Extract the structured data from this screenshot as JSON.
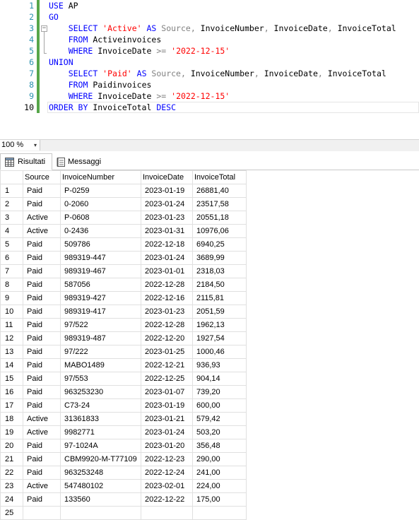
{
  "editor": {
    "lines": [
      {
        "n": "1",
        "tokens": [
          {
            "c": "kw",
            "t": "USE "
          },
          {
            "c": "plain",
            "t": "AP"
          }
        ]
      },
      {
        "n": "2",
        "tokens": [
          {
            "c": "kw",
            "t": "GO"
          }
        ]
      },
      {
        "n": "3",
        "tokens": [
          {
            "c": "plain",
            "t": "    "
          },
          {
            "c": "kw",
            "t": "SELECT "
          },
          {
            "c": "str",
            "t": "'Active'"
          },
          {
            "c": "kw",
            "t": " AS "
          },
          {
            "c": "fn",
            "t": "Source"
          },
          {
            "c": "op",
            "t": ", "
          },
          {
            "c": "plain",
            "t": "InvoiceNumber"
          },
          {
            "c": "op",
            "t": ", "
          },
          {
            "c": "plain",
            "t": "InvoiceDate"
          },
          {
            "c": "op",
            "t": ", "
          },
          {
            "c": "plain",
            "t": "InvoiceTotal"
          }
        ]
      },
      {
        "n": "4",
        "tokens": [
          {
            "c": "plain",
            "t": "    "
          },
          {
            "c": "kw",
            "t": "FROM "
          },
          {
            "c": "plain",
            "t": "Activeinvoices"
          }
        ]
      },
      {
        "n": "5",
        "tokens": [
          {
            "c": "plain",
            "t": "    "
          },
          {
            "c": "kw",
            "t": "WHERE "
          },
          {
            "c": "plain",
            "t": "InvoiceDate "
          },
          {
            "c": "op",
            "t": ">="
          },
          {
            "c": "plain",
            "t": " "
          },
          {
            "c": "str",
            "t": "'2022-12-15'"
          }
        ]
      },
      {
        "n": "6",
        "tokens": [
          {
            "c": "kw",
            "t": "UNION"
          }
        ]
      },
      {
        "n": "7",
        "tokens": [
          {
            "c": "plain",
            "t": "    "
          },
          {
            "c": "kw",
            "t": "SELECT "
          },
          {
            "c": "str",
            "t": "'Paid'"
          },
          {
            "c": "kw",
            "t": " AS "
          },
          {
            "c": "fn",
            "t": "Source"
          },
          {
            "c": "op",
            "t": ", "
          },
          {
            "c": "plain",
            "t": "InvoiceNumber"
          },
          {
            "c": "op",
            "t": ", "
          },
          {
            "c": "plain",
            "t": "InvoiceDate"
          },
          {
            "c": "op",
            "t": ", "
          },
          {
            "c": "plain",
            "t": "InvoiceTotal"
          }
        ]
      },
      {
        "n": "8",
        "tokens": [
          {
            "c": "plain",
            "t": "    "
          },
          {
            "c": "kw",
            "t": "FROM "
          },
          {
            "c": "plain",
            "t": "Paidinvoices"
          }
        ]
      },
      {
        "n": "9",
        "tokens": [
          {
            "c": "plain",
            "t": "    "
          },
          {
            "c": "kw",
            "t": "WHERE "
          },
          {
            "c": "plain",
            "t": "InvoiceDate "
          },
          {
            "c": "op",
            "t": ">="
          },
          {
            "c": "plain",
            "t": " "
          },
          {
            "c": "str",
            "t": "'2022-12-15'"
          }
        ]
      },
      {
        "n": "10",
        "tokens": [
          {
            "c": "kw",
            "t": "ORDER BY "
          },
          {
            "c": "plain",
            "t": "InvoiceTotal "
          },
          {
            "c": "kw",
            "t": "DESC"
          }
        ]
      }
    ],
    "fold_marker": "−"
  },
  "zoom": {
    "value": "100 %",
    "arrow": "▾"
  },
  "tabs": {
    "results_label": "Risultati",
    "messages_label": "Messaggi"
  },
  "grid": {
    "columns": [
      "",
      "Source",
      "InvoiceNumber",
      "InvoiceDate",
      "InvoiceTotal"
    ],
    "rows": [
      [
        "1",
        "Paid",
        "P-0259",
        "2023-01-19",
        "26881,40"
      ],
      [
        "2",
        "Paid",
        "0-2060",
        "2023-01-24",
        "23517,58"
      ],
      [
        "3",
        "Active",
        "P-0608",
        "2023-01-23",
        "20551,18"
      ],
      [
        "4",
        "Active",
        "0-2436",
        "2023-01-31",
        "10976,06"
      ],
      [
        "5",
        "Paid",
        "509786",
        "2022-12-18",
        "6940,25"
      ],
      [
        "6",
        "Paid",
        "989319-447",
        "2023-01-24",
        "3689,99"
      ],
      [
        "7",
        "Paid",
        "989319-467",
        "2023-01-01",
        "2318,03"
      ],
      [
        "8",
        "Paid",
        "587056",
        "2022-12-28",
        "2184,50"
      ],
      [
        "9",
        "Paid",
        "989319-427",
        "2022-12-16",
        "2115,81"
      ],
      [
        "10",
        "Paid",
        "989319-417",
        "2023-01-23",
        "2051,59"
      ],
      [
        "11",
        "Paid",
        "97/522",
        "2022-12-28",
        "1962,13"
      ],
      [
        "12",
        "Paid",
        "989319-487",
        "2022-12-20",
        "1927,54"
      ],
      [
        "13",
        "Paid",
        "97/222",
        "2023-01-25",
        "1000,46"
      ],
      [
        "14",
        "Paid",
        "MABO1489",
        "2022-12-21",
        "936,93"
      ],
      [
        "15",
        "Paid",
        "97/553",
        "2022-12-25",
        "904,14"
      ],
      [
        "16",
        "Paid",
        "963253230",
        "2023-01-07",
        "739,20"
      ],
      [
        "17",
        "Paid",
        "C73-24",
        "2023-01-19",
        "600,00"
      ],
      [
        "18",
        "Active",
        "31361833",
        "2023-01-21",
        "579,42"
      ],
      [
        "19",
        "Active",
        "9982771",
        "2023-01-24",
        "503,20"
      ],
      [
        "20",
        "Paid",
        "97-1024A",
        "2023-01-20",
        "356,48"
      ],
      [
        "21",
        "Paid",
        "CBM9920-M-T77109",
        "2022-12-23",
        "290,00"
      ],
      [
        "22",
        "Paid",
        "963253248",
        "2022-12-24",
        "241,00"
      ],
      [
        "23",
        "Active",
        "547480102",
        "2023-02-01",
        "224,00"
      ],
      [
        "24",
        "Paid",
        "133560",
        "2022-12-22",
        "175,00"
      ],
      [
        "25",
        "",
        "",
        "",
        ""
      ]
    ]
  }
}
